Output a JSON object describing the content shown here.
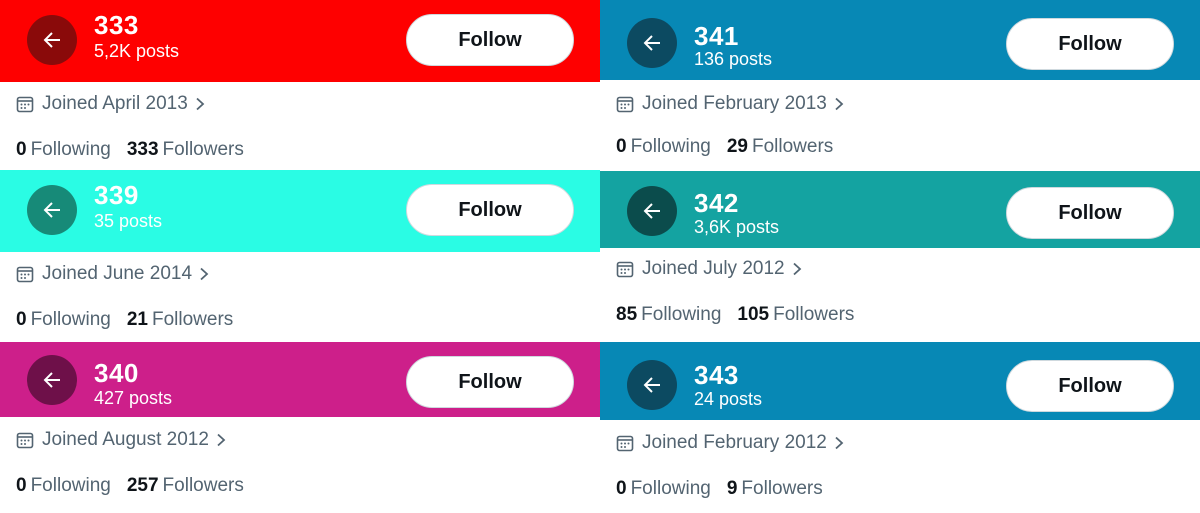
{
  "colors": {
    "primary_text": "#0f1419",
    "secondary_text": "#536471",
    "follow_button_bg": "#ffffff"
  },
  "icons": {
    "back": "left-arrow-icon",
    "calendar": "calendar-icon",
    "chevron": "chevron-right-icon"
  },
  "profiles": [
    {
      "name": "333",
      "posts": "5,2K posts",
      "follow_label": "Follow",
      "joined": "Joined April 2013",
      "following_count": "0",
      "following_label": "Following",
      "followers_count": "333",
      "followers_label": "Followers",
      "banner_color": "#fe0000",
      "button_circle_color": "#8a0a0a"
    },
    {
      "name": "339",
      "posts": "35 posts",
      "follow_label": "Follow",
      "joined": "Joined June 2014",
      "following_count": "0",
      "following_label": "Following",
      "followers_count": "21",
      "followers_label": "Followers",
      "banner_color": "#2afce4",
      "button_circle_color": "#178a78"
    },
    {
      "name": "340",
      "posts": "427 posts",
      "follow_label": "Follow",
      "joined": "Joined August 2012",
      "following_count": "0",
      "following_label": "Following",
      "followers_count": "257",
      "followers_label": "Followers",
      "banner_color": "#cd1f8a",
      "button_circle_color": "#6e1049"
    },
    {
      "name": "341",
      "posts": "136 posts",
      "follow_label": "Follow",
      "joined": "Joined February 2013",
      "following_count": "0",
      "following_label": "Following",
      "followers_count": "29",
      "followers_label": "Followers",
      "banner_color": "#0788b5",
      "button_circle_color": "#0c4a61"
    },
    {
      "name": "342",
      "posts": "3,6K posts",
      "follow_label": "Follow",
      "joined": "Joined July 2012",
      "following_count": "85",
      "following_label": "Following",
      "followers_count": "105",
      "followers_label": "Followers",
      "banner_color": "#14a3a1",
      "button_circle_color": "#0b4c4c"
    },
    {
      "name": "343",
      "posts": "24 posts",
      "follow_label": "Follow",
      "joined": "Joined February 2012",
      "following_count": "0",
      "following_label": "Following",
      "followers_count": "9",
      "followers_label": "Followers",
      "banner_color": "#0788b5",
      "button_circle_color": "#0c4a61"
    }
  ]
}
